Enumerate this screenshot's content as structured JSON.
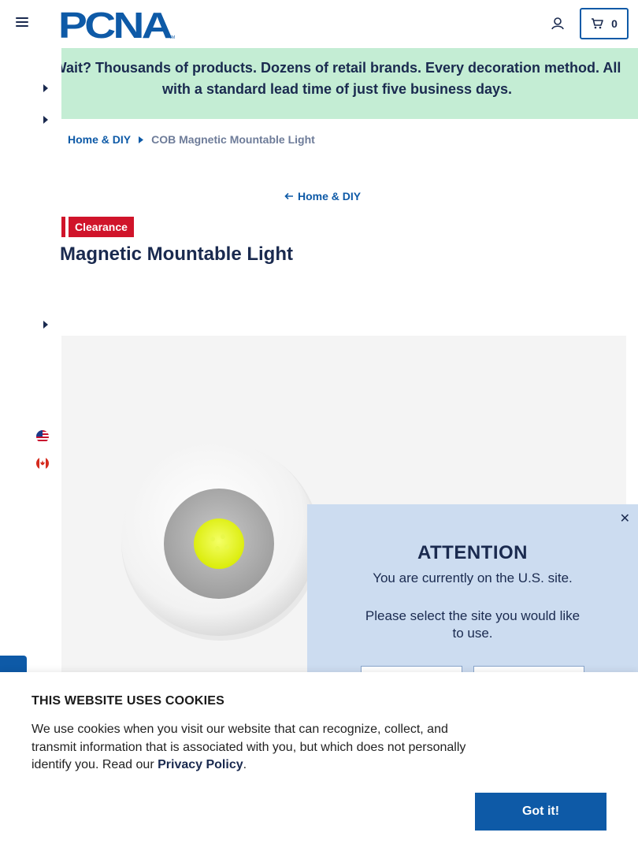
{
  "header": {
    "logo_text": "PCNA",
    "logo_tm": "TM",
    "cart_count": "0"
  },
  "promo": {
    "text": "Wait? Thousands of products. Dozens of retail brands. Every decoration method. All with a standard lead time of just five business days."
  },
  "breadcrumb": {
    "parent": "Home & DIY",
    "current": "COB Magnetic Mountable Light"
  },
  "back_link": {
    "label": "Home & DIY"
  },
  "product": {
    "badge": "Clearance",
    "title": "Magnetic Mountable Light"
  },
  "attention": {
    "close": "✕",
    "title": "ATTENTION",
    "message": "You are currently on the U.S. site.",
    "prompt": "Please select the site you would like to use."
  },
  "cookie": {
    "title": "THIS WEBSITE USES COOKIES",
    "text_before": "We use cookies when you visit our website that can recognize, collect, and transmit information that is associated with you, but which does not personally identify you. Read our ",
    "link": "Privacy Policy",
    "text_after": ".",
    "button": "Got it!"
  },
  "colors": {
    "brand_blue": "#0e5aa7",
    "navy": "#1a2a4f",
    "promo_bg": "#c4edd4",
    "clearance_red": "#d0142a",
    "attention_bg": "#ccdcf0"
  },
  "icons": {
    "menu": "hamburger-icon",
    "account": "user-icon",
    "cart": "cart-icon",
    "back": "arrow-left-icon",
    "breadcrumb_sep": "caret-right-icon",
    "flags": [
      "us-flag-icon",
      "canada-flag-icon"
    ]
  }
}
